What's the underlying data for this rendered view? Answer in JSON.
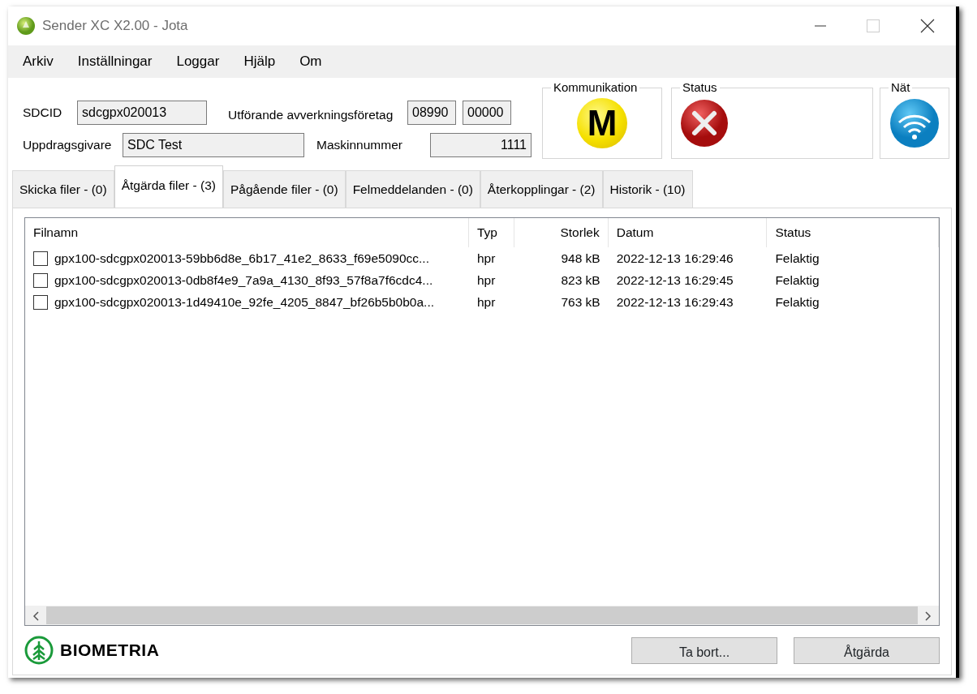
{
  "window": {
    "title": "Sender XC X2.00 - Jota"
  },
  "menu": [
    "Arkiv",
    "Inställningar",
    "Loggar",
    "Hjälp",
    "Om"
  ],
  "header": {
    "sdcid_label": "SDCID",
    "sdcid_value": "sdcgpx020013",
    "uppdragsgivare_label": "Uppdragsgivare",
    "uppdragsgivare_value": "SDC Test",
    "foretag_label": "Utförande avverkningsföretag",
    "foretag_values": [
      "08990",
      "00000"
    ],
    "maskin_label": "Maskinnummer",
    "maskin_value": "1111"
  },
  "groups": [
    {
      "title": "Kommunikation",
      "kind": "mode",
      "symbol": "M"
    },
    {
      "title": "Status",
      "kind": "error"
    },
    {
      "title": "Nät",
      "kind": "network"
    }
  ],
  "tabs": [
    {
      "label": "Skicka filer - (0)",
      "selected": false
    },
    {
      "label": "Åtgärda filer - (3)",
      "selected": true
    },
    {
      "label": "Pågående filer - (0)",
      "selected": false
    },
    {
      "label": "Felmeddelanden - (0)",
      "selected": false
    },
    {
      "label": "Återkopplingar - (2)",
      "selected": false
    },
    {
      "label": "Historik - (10)",
      "selected": false
    }
  ],
  "table": {
    "columns": [
      "Filnamn",
      "Typ",
      "Storlek",
      "Datum",
      "Status"
    ],
    "rows": [
      {
        "checked": false,
        "cells": [
          "gpx100-sdcgpx020013-59bb6d8e_6b17_41e2_8633_f69e5090cc...",
          "hpr",
          "948 kB",
          "2022-12-13 16:29:46",
          "Felaktig"
        ]
      },
      {
        "checked": false,
        "cells": [
          "gpx100-sdcgpx020013-0db8f4e9_7a9a_4130_8f93_57f8a7f6cdc4...",
          "hpr",
          "823 kB",
          "2022-12-13 16:29:45",
          "Felaktig"
        ]
      },
      {
        "checked": false,
        "cells": [
          "gpx100-sdcgpx020013-1d49410e_92fe_4205_8847_bf26b5b0b0a...",
          "hpr",
          "763 kB",
          "2022-12-13 16:29:43",
          "Felaktig"
        ]
      }
    ]
  },
  "logo": "BIOMETRIA",
  "buttons": [
    "Ta bort...",
    "Åtgärda"
  ]
}
